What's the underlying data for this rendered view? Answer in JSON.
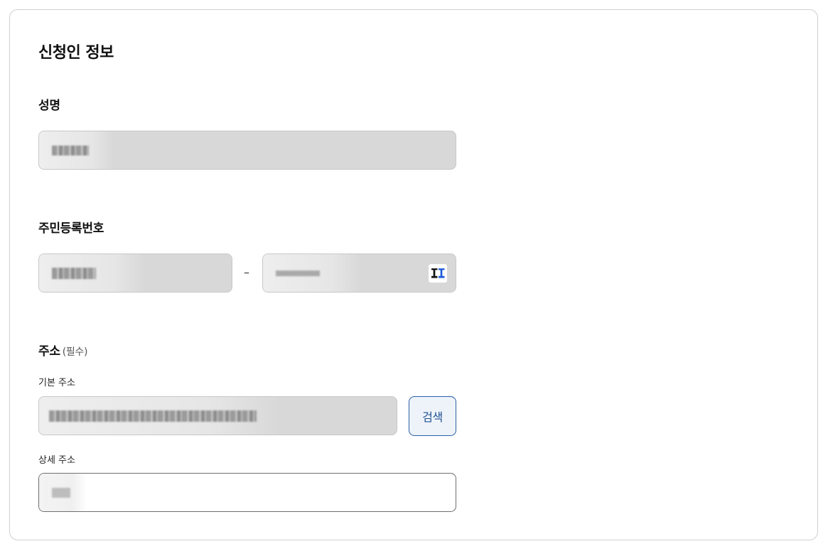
{
  "section": {
    "title": "신청인 정보"
  },
  "name": {
    "label": "성명"
  },
  "resident_number": {
    "label": "주민등록번호",
    "separator": "–",
    "keypad_icon": "security-keypad-icon"
  },
  "address": {
    "label": "주소",
    "required_note": "(필수)",
    "base_label": "기본 주소",
    "search_label": "검색",
    "detail_label": "상세 주소"
  },
  "colors": {
    "readonly_bg": "#d8d8d8",
    "accent": "#1f4f8f",
    "border": "#cfcfcf"
  }
}
